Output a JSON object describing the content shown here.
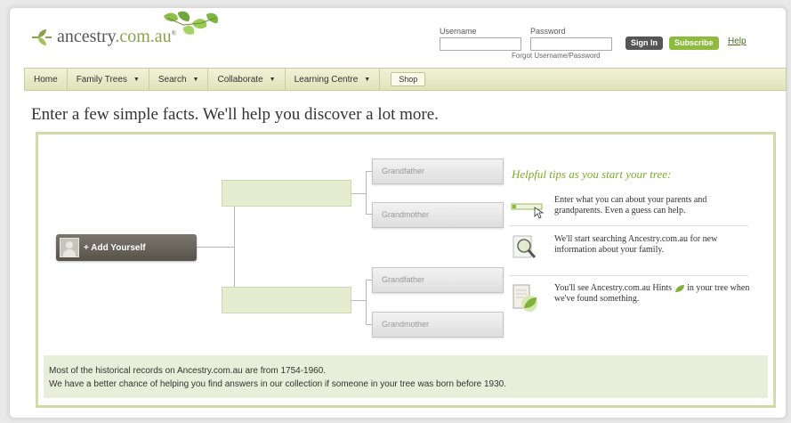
{
  "header": {
    "logo_text": "ancestry",
    "logo_domain": ".com.au",
    "logo_tm": "®",
    "username_label": "Username",
    "password_label": "Password",
    "forgot_link": "Forgot Username/Password",
    "sign_in_label": "Sign In",
    "subscribe_label": "Subscribe",
    "help_label": "Help"
  },
  "nav": {
    "items": [
      {
        "label": "Home"
      },
      {
        "label": "Family Trees",
        "caret": "▼"
      },
      {
        "label": "Search",
        "caret": "▼"
      },
      {
        "label": "Collaborate",
        "caret": "▼"
      },
      {
        "label": "Learning Centre",
        "caret": "▼"
      }
    ],
    "shop_label": "Shop"
  },
  "main": {
    "headline": "Enter a few simple facts. We'll help you discover a lot more.",
    "tree": {
      "self_label": "+ Add Yourself",
      "grandparents": [
        "Grandfather",
        "Grandmother",
        "Grandfather",
        "Grandmother"
      ]
    },
    "tips": {
      "title": "Helpful tips as you start your tree:",
      "items": [
        {
          "text": "Enter what you can about your parents and grandparents. Even a guess can help.",
          "icon": "form-pointer-icon"
        },
        {
          "text": "We'll start searching Ancestry.com.au for new information about your family.",
          "icon": "magnifier-icon"
        },
        {
          "text_before": "You'll see Ancestry.com.au Hints",
          "text_after": "in your tree when we've found something.",
          "icon": "hint-leaf-icon"
        }
      ]
    },
    "footer_note": {
      "line1": "Most of the historical records on Ancestry.com.au are from 1754-1960.",
      "line2": "We have a better chance of helping you find answers in our collection if someone in your tree was born before 1930."
    }
  },
  "colors": {
    "accent_green": "#8dbb3e",
    "nav_bg": "#e7e9c6",
    "panel_border": "#cfdca8",
    "dark_button": "#57534b"
  }
}
